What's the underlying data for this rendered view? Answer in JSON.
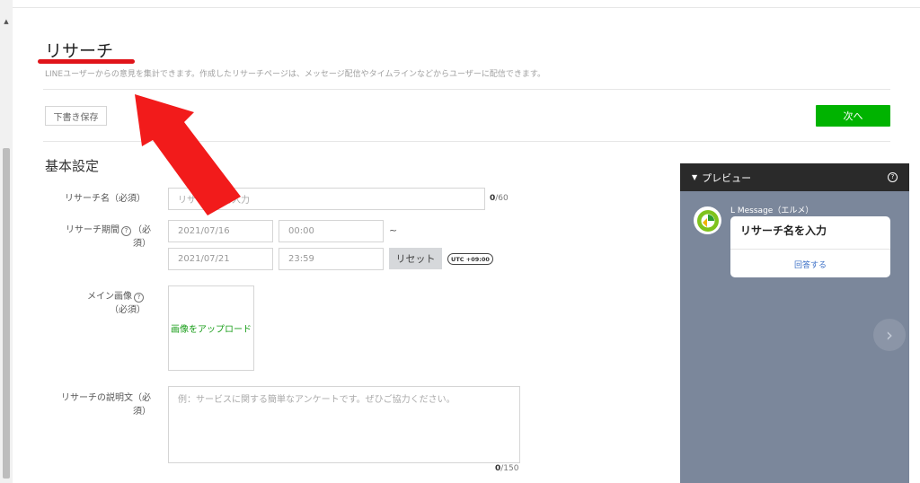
{
  "header": {
    "title": "リサーチ",
    "subtitle": "LINEユーザーからの意見を集計できます。作成したリサーチページは、メッセージ配信やタイムラインなどからユーザーに配信できます。",
    "draft_button": "下書き保存",
    "next_button": "次へ"
  },
  "section": {
    "title": "基本設定"
  },
  "form": {
    "name_label": "リサーチ名（必須）",
    "name_placeholder": "リサーチ名を入力",
    "name_counter_value": "0",
    "name_counter_max": "/60",
    "period_label_line1": "リサーチ期間",
    "period_label_line2": "（必",
    "period_label_line3": "須）",
    "start_date": "2021/07/16",
    "start_time": "00:00",
    "tilde": "~",
    "end_date": "2021/07/21",
    "end_time": "23:59",
    "reset_button": "リセット",
    "timezone_badge": "UTC +09:00",
    "image_label_line1": "メイン画像",
    "image_label_line2": "（必須）",
    "upload_link": "画像をアップロード",
    "desc_label_line1": "リサーチの説明文（必",
    "desc_label_line2": "須）",
    "desc_placeholder": "例：サービスに関する簡単なアンケートです。ぜひご協力ください。",
    "desc_counter_value": "0",
    "desc_counter_max": "/150"
  },
  "preview": {
    "header_label": "プレビュー",
    "sender_name": "L Message（エルメ）",
    "card_title": "リサーチ名を入力",
    "card_link": "回答する"
  },
  "colors": {
    "accent_green": "#00b300",
    "underline_red": "#e0141a",
    "arrow_red": "#f21b1b",
    "preview_bg": "#7b879b"
  },
  "icons": [
    "help-icon",
    "chevron-right-icon",
    "caret-down-icon",
    "scroll-up-icon",
    "arrow-annotation-icon"
  ]
}
